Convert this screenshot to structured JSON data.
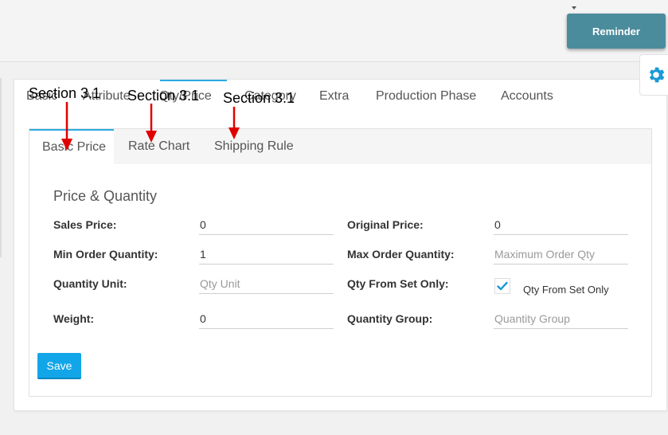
{
  "header": {
    "reminder_label": "Reminder"
  },
  "icons": {
    "gear": "gear-icon",
    "check": "checkmark-icon"
  },
  "main_tabs": [
    {
      "label": "Basic"
    },
    {
      "label": "Attribute"
    },
    {
      "label": "Qty/Price"
    },
    {
      "label": "Category"
    },
    {
      "label": "Extra"
    },
    {
      "label": "Production Phase"
    },
    {
      "label": "Accounts"
    }
  ],
  "sub_tabs": [
    {
      "label": "Basic Price",
      "active": true
    },
    {
      "label": "Rate Chart"
    },
    {
      "label": "Shipping Rule"
    }
  ],
  "form": {
    "title": "Price & Quantity",
    "sales_price": {
      "label": "Sales Price:",
      "value": "0"
    },
    "original_price": {
      "label": "Original Price:",
      "value": "0"
    },
    "min_order_qty": {
      "label": "Min Order Quantity:",
      "value": "1"
    },
    "max_order_qty": {
      "label": "Max Order Quantity:",
      "placeholder": "Maximum Order Qty"
    },
    "quantity_unit": {
      "label": "Quantity Unit:",
      "placeholder": "Qty Unit"
    },
    "qty_from_set": {
      "label": "Qty From Set Only:",
      "checkbox_label": "Qty From Set Only",
      "checked": true
    },
    "weight": {
      "label": "Weight:",
      "value": "0"
    },
    "quantity_group": {
      "label": "Quantity Group:",
      "placeholder": "Quantity Group"
    },
    "save_label": "Save"
  },
  "annotations": [
    {
      "text": "Section 3.1"
    },
    {
      "text": "Section 3.1"
    },
    {
      "text": "Section 3.1"
    }
  ],
  "colors": {
    "accent": "#29abe2",
    "reminder_bg": "#4b8c9c",
    "save_bg": "#12a6e9",
    "annotation_arrow": "#e00000"
  }
}
